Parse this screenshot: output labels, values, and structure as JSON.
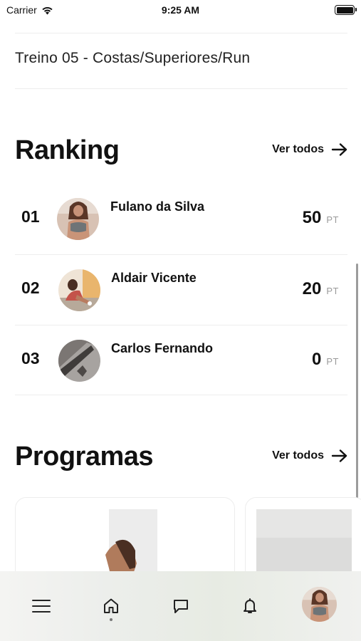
{
  "status_bar": {
    "carrier": "Carrier",
    "time": "9:25 AM"
  },
  "workout": {
    "title": "Treino 05 - Costas/Superiores/Run"
  },
  "ranking": {
    "title": "Ranking",
    "see_all": "Ver todos",
    "rows": [
      {
        "position": "01",
        "name": "Fulano da Silva",
        "score": "50",
        "unit": "PT"
      },
      {
        "position": "02",
        "name": "Aldair Vicente",
        "score": "20",
        "unit": "PT"
      },
      {
        "position": "03",
        "name": "Carlos Fernando",
        "score": "0",
        "unit": "PT"
      }
    ]
  },
  "programs": {
    "title": "Programas",
    "see_all": "Ver todos"
  },
  "bottom_nav": {
    "active": "home",
    "items": [
      "menu-icon",
      "home-icon",
      "chat-icon",
      "bell-icon",
      "profile-avatar"
    ]
  },
  "colors": {
    "text": "#111111",
    "muted": "#9a9a9a",
    "divider": "#ededed"
  }
}
